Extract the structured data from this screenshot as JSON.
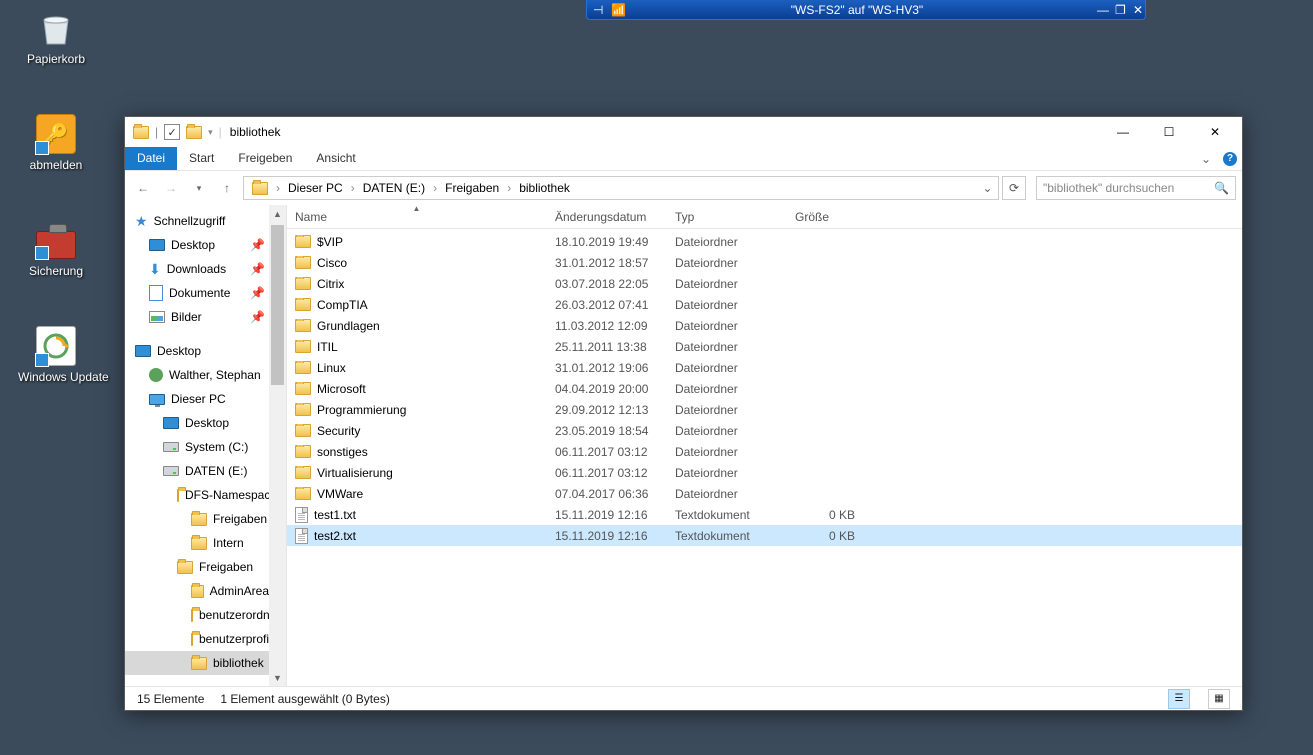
{
  "desktop": {
    "recycle": "Papierkorb",
    "logoff": "abmelden",
    "backup": "Sicherung",
    "winupdate": "Windows Update"
  },
  "remote_bar": {
    "title": "\"WS-FS2\" auf \"WS-HV3\""
  },
  "explorer": {
    "title": "bibliothek",
    "tabs": {
      "file": "Datei",
      "start": "Start",
      "share": "Freigeben",
      "view": "Ansicht"
    },
    "breadcrumb": [
      "Dieser PC",
      "DATEN (E:)",
      "Freigaben",
      "bibliothek"
    ],
    "search_placeholder": "\"bibliothek\" durchsuchen",
    "tree": {
      "quick": "Schnellzugriff",
      "desktop": "Desktop",
      "downloads": "Downloads",
      "documents": "Dokumente",
      "pictures": "Bilder",
      "desktop2": "Desktop",
      "user": "Walther, Stephan",
      "thispc": "Dieser PC",
      "desktop3": "Desktop",
      "cdrive": "System (C:)",
      "edrive": "DATEN (E:)",
      "dfs": "DFS-Namespaces",
      "freigaben1": "Freigaben",
      "intern": "Intern",
      "freigaben2": "Freigaben",
      "adminarea": "AdminArea",
      "benutzerord": "benutzerordner",
      "benutzerpro": "benutzerprofile",
      "bibliothek": "bibliothek"
    },
    "columns": {
      "name": "Name",
      "date": "Änderungsdatum",
      "type": "Typ",
      "size": "Größe"
    },
    "rows": [
      {
        "name": "$VIP",
        "date": "18.10.2019 19:49",
        "type": "Dateiordner",
        "size": "",
        "kind": "folder"
      },
      {
        "name": "Cisco",
        "date": "31.01.2012 18:57",
        "type": "Dateiordner",
        "size": "",
        "kind": "folder"
      },
      {
        "name": "Citrix",
        "date": "03.07.2018 22:05",
        "type": "Dateiordner",
        "size": "",
        "kind": "folder"
      },
      {
        "name": "CompTIA",
        "date": "26.03.2012 07:41",
        "type": "Dateiordner",
        "size": "",
        "kind": "folder"
      },
      {
        "name": "Grundlagen",
        "date": "11.03.2012 12:09",
        "type": "Dateiordner",
        "size": "",
        "kind": "folder"
      },
      {
        "name": "ITIL",
        "date": "25.11.2011 13:38",
        "type": "Dateiordner",
        "size": "",
        "kind": "folder"
      },
      {
        "name": "Linux",
        "date": "31.01.2012 19:06",
        "type": "Dateiordner",
        "size": "",
        "kind": "folder"
      },
      {
        "name": "Microsoft",
        "date": "04.04.2019 20:00",
        "type": "Dateiordner",
        "size": "",
        "kind": "folder"
      },
      {
        "name": "Programmierung",
        "date": "29.09.2012 12:13",
        "type": "Dateiordner",
        "size": "",
        "kind": "folder"
      },
      {
        "name": "Security",
        "date": "23.05.2019 18:54",
        "type": "Dateiordner",
        "size": "",
        "kind": "folder"
      },
      {
        "name": "sonstiges",
        "date": "06.11.2017 03:12",
        "type": "Dateiordner",
        "size": "",
        "kind": "folder"
      },
      {
        "name": "Virtualisierung",
        "date": "06.11.2017 03:12",
        "type": "Dateiordner",
        "size": "",
        "kind": "folder"
      },
      {
        "name": "VMWare",
        "date": "07.04.2017 06:36",
        "type": "Dateiordner",
        "size": "",
        "kind": "folder"
      },
      {
        "name": "test1.txt",
        "date": "15.11.2019 12:16",
        "type": "Textdokument",
        "size": "0 KB",
        "kind": "file"
      },
      {
        "name": "test2.txt",
        "date": "15.11.2019 12:16",
        "type": "Textdokument",
        "size": "0 KB",
        "kind": "file",
        "selected": true
      }
    ],
    "status": {
      "count": "15 Elemente",
      "selection": "1 Element ausgewählt (0 Bytes)"
    }
  }
}
